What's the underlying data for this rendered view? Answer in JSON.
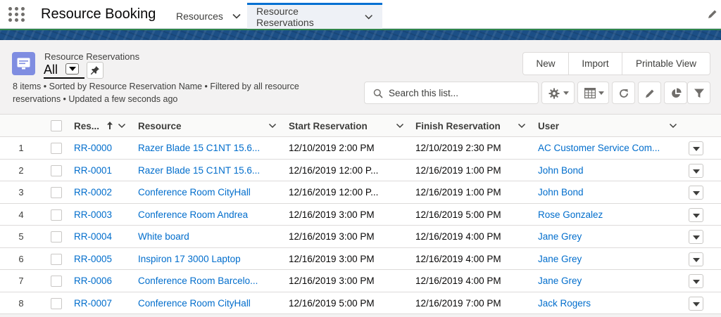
{
  "app": {
    "title": "Resource Booking",
    "nav_tabs": [
      {
        "label": "Resources",
        "active": false
      },
      {
        "label": "Resource Reservations",
        "active": true
      }
    ]
  },
  "list": {
    "object_label": "Resource Reservations",
    "view_name": "All",
    "meta": "8 items • Sorted by Resource Reservation Name • Filtered by all resource reservations • Updated a few seconds ago",
    "buttons": {
      "new": "New",
      "import": "Import",
      "printable_view": "Printable View"
    },
    "search_placeholder": "Search this list...",
    "columns": {
      "name": "Res...",
      "resource": "Resource",
      "start": "Start Reservation",
      "finish": "Finish Reservation",
      "user": "User"
    },
    "sorted_by": "name",
    "sort_direction": "ascending",
    "rows": [
      {
        "num": "1",
        "name": "RR-0000",
        "resource": "Razer Blade 15 C1NT 15.6...",
        "start": "12/10/2019 2:00 PM",
        "finish": "12/10/2019 2:30 PM",
        "user": "AC Customer Service Com..."
      },
      {
        "num": "2",
        "name": "RR-0001",
        "resource": "Razer Blade 15 C1NT 15.6...",
        "start": "12/16/2019 12:00 P...",
        "finish": "12/16/2019 1:00 PM",
        "user": "John Bond"
      },
      {
        "num": "3",
        "name": "RR-0002",
        "resource": "Conference Room CityHall",
        "start": "12/16/2019 12:00 P...",
        "finish": "12/16/2019 1:00 PM",
        "user": "John Bond"
      },
      {
        "num": "4",
        "name": "RR-0003",
        "resource": "Conference Room Andrea",
        "start": "12/16/2019 3:00 PM",
        "finish": "12/16/2019 5:00 PM",
        "user": "Rose Gonzalez"
      },
      {
        "num": "5",
        "name": "RR-0004",
        "resource": "White board",
        "start": "12/16/2019 3:00 PM",
        "finish": "12/16/2019 4:00 PM",
        "user": "Jane Grey"
      },
      {
        "num": "6",
        "name": "RR-0005",
        "resource": "Inspiron 17 3000 Laptop",
        "start": "12/16/2019 3:00 PM",
        "finish": "12/16/2019 4:00 PM",
        "user": "Jane Grey"
      },
      {
        "num": "7",
        "name": "RR-0006",
        "resource": "Conference Room Barcelo...",
        "start": "12/16/2019 3:00 PM",
        "finish": "12/16/2019 4:00 PM",
        "user": "Jane Grey"
      },
      {
        "num": "8",
        "name": "RR-0007",
        "resource": "Conference Room CityHall",
        "start": "12/16/2019 5:00 PM",
        "finish": "12/16/2019 7:00 PM",
        "user": "Jack Rogers"
      }
    ]
  },
  "icons": {
    "app_launcher": "waffle-icon",
    "nav_chevron": "chevron-down-icon",
    "edit_nav": "pencil-icon",
    "object": "list-icon",
    "pin": "pin-icon",
    "search": "search-icon",
    "settings": "gear-icon",
    "display_as": "table-icon",
    "refresh": "refresh-icon",
    "inline_edit": "edit-icon",
    "charts": "chart-icon",
    "filters": "filter-icon"
  },
  "colors": {
    "link": "#006dcc",
    "accent": "#0070d2",
    "object_icon": "#7f8de1",
    "banner": "#1c4f86"
  }
}
